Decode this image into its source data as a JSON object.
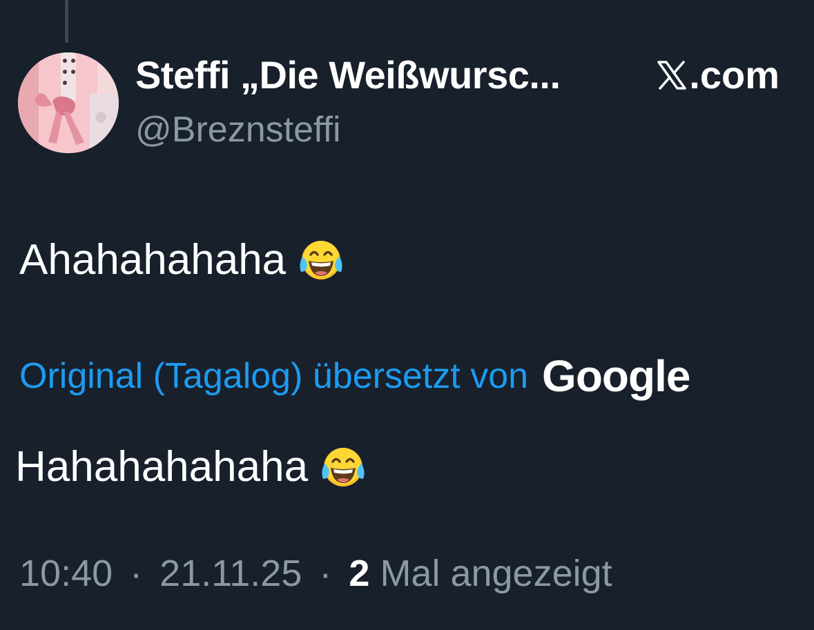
{
  "post": {
    "author": {
      "display_name": "Steffi „Die Weißwursc...",
      "handle": "@Breznsteffi",
      "avatar_icon": "avatar-photo-dirndl"
    },
    "site": {
      "logo_icon": "x-logo-icon",
      "label": ".com"
    },
    "text_original": "Ahahahahaha",
    "emoji_icon": "face-with-tears-of-joy-icon",
    "translation": {
      "link_text": "Original (Tagalog) übersetzt von",
      "provider": "Google"
    },
    "text_translated": "Hahahahahaha",
    "meta": {
      "time": "10:40",
      "separator": "·",
      "date": "21.11.25",
      "views_count": "2",
      "views_label": "Mal angezeigt"
    }
  },
  "colors": {
    "background": "#17202b",
    "link": "#1d9bf0",
    "muted": "#8b98a5",
    "text": "#ffffff"
  }
}
